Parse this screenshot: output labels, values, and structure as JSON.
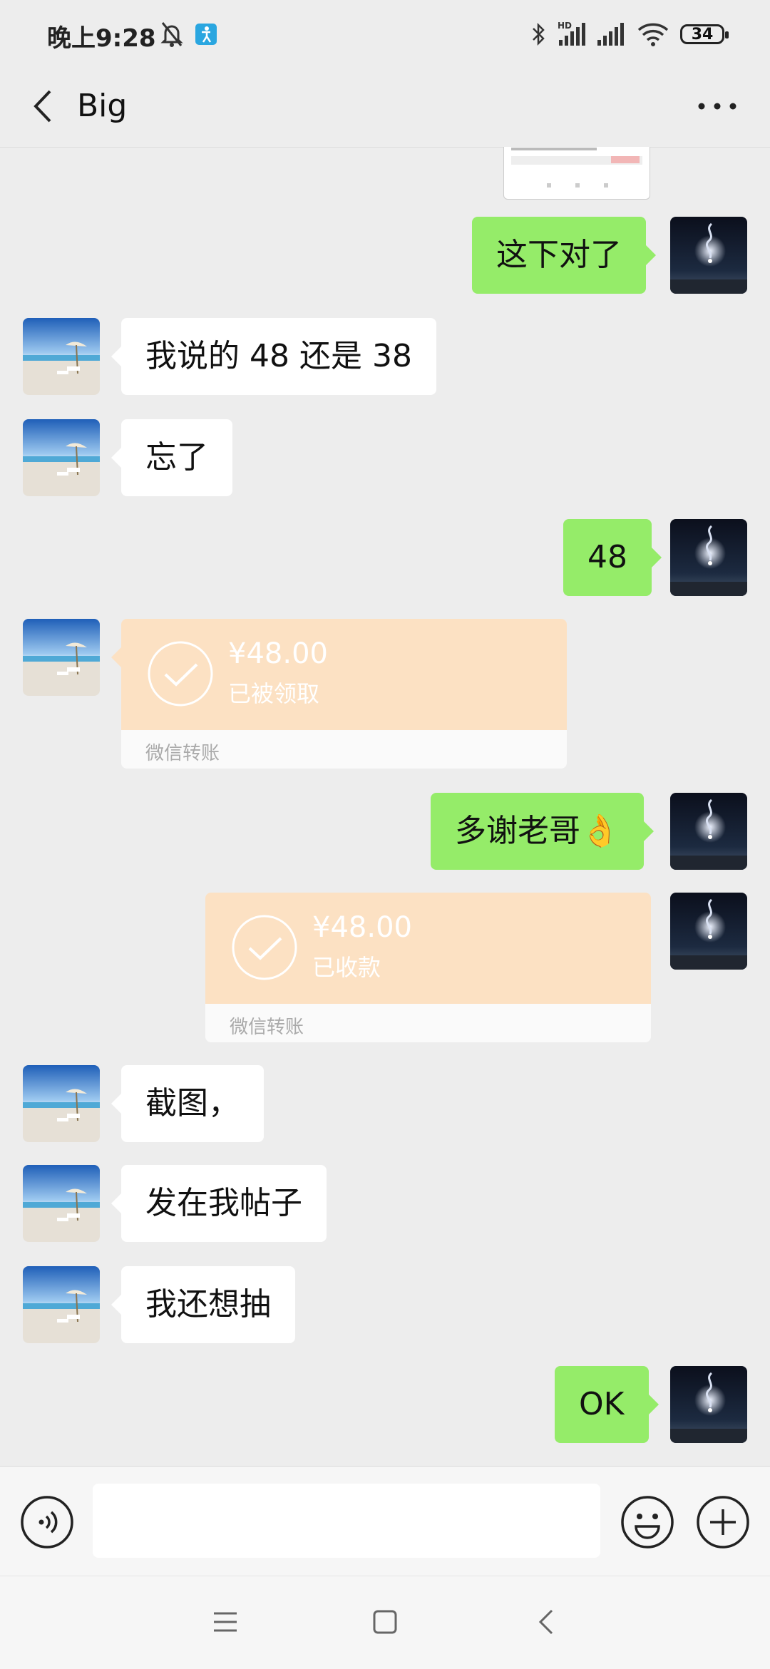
{
  "status_bar": {
    "time": "晚上9:28",
    "battery": "34",
    "network": "HD"
  },
  "header": {
    "title": "Big"
  },
  "messages": [
    {
      "id": "m1",
      "side": "out",
      "text": "这下对了"
    },
    {
      "id": "m2",
      "side": "in",
      "text": "我说的 48 还是 38"
    },
    {
      "id": "m3",
      "side": "in",
      "text": "忘了"
    },
    {
      "id": "m4",
      "side": "out",
      "text": "48"
    },
    {
      "id": "m5",
      "side": "in",
      "type": "transfer",
      "amount": "¥48.00",
      "status": "已被领取",
      "label": "微信转账"
    },
    {
      "id": "m6",
      "side": "out",
      "text": "多谢老哥👌"
    },
    {
      "id": "m7",
      "side": "out",
      "type": "transfer",
      "amount": "¥48.00",
      "status": "已收款",
      "label": "微信转账"
    },
    {
      "id": "m8",
      "side": "in",
      "text": "截图，"
    },
    {
      "id": "m9",
      "side": "in",
      "text": "发在我帖子"
    },
    {
      "id": "m10",
      "side": "in",
      "text": "我还想抽"
    },
    {
      "id": "m11",
      "side": "out",
      "text": "OK"
    }
  ],
  "input_bar": {
    "value": "",
    "icons": [
      "voice-icon",
      "emoji-icon",
      "plus-icon"
    ]
  },
  "nav_bar": {
    "icons": [
      "menu-icon",
      "home-icon",
      "back-icon"
    ]
  },
  "colors": {
    "outgoing_bubble": "#95ec69",
    "incoming_bubble": "#ffffff",
    "transfer": "#fce1c3",
    "background": "#ededed"
  }
}
